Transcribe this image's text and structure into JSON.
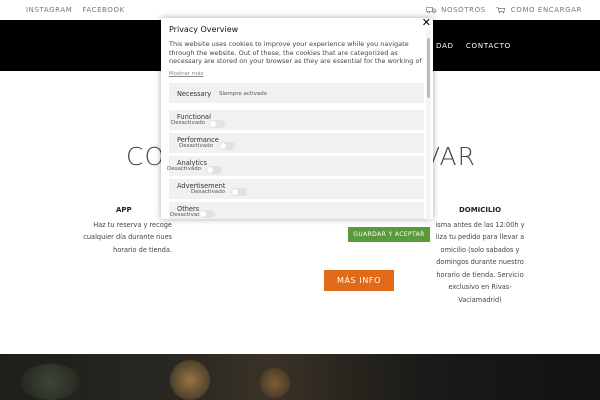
{
  "topbar": {
    "instagram": "INSTAGRAM",
    "facebook": "FACEBOOK",
    "nosotros": "NOSOTROS",
    "como_encargar": "COMO ENCARGAR"
  },
  "nav": {
    "partial_item": "DAD",
    "contacto": "CONTACTO"
  },
  "main": {
    "title_left": "CO",
    "title_right": "VAR",
    "app": {
      "title": "APP",
      "lines": [
        "Haz tu reserva y recoge",
        "cualquier día durante nues",
        "horario de tienda."
      ]
    },
    "domicilio": {
      "title": "DOMICILIO",
      "lines": [
        "isma antes de las 12:00h  y",
        "liza tu pedido para llevar a",
        "omicilio (solo sabados y",
        "domingos durante nuestro",
        "horario de tienda. Servicio",
        "exclusivo en Rivas-Vaciamadrid)"
      ]
    },
    "mas_info": "MÁS INFO"
  },
  "modal": {
    "title": "Privacy Overview",
    "description": "This website uses cookies to improve your experience while you navigate through the website. Out of these, the cookies that are categorized as necessary are stored on your browser as they are essential for the working of basic",
    "show_more": "Mostrar más",
    "categories": [
      {
        "name": "Necessary",
        "status": "Siempre activado",
        "toggle": false
      },
      {
        "name": "Functional",
        "status": "Desactivado",
        "toggle": true
      },
      {
        "name": "Performance",
        "status": "Desactivado",
        "toggle": true
      },
      {
        "name": "Analytics",
        "status": "Desactivado",
        "toggle": true
      },
      {
        "name": "Advertisement",
        "status": "Desactivado",
        "toggle": true
      },
      {
        "name": "Others",
        "status": "Desactivado",
        "toggle": true
      }
    ],
    "accept_button": "GUARDAR Y ACEPTAR"
  },
  "colors": {
    "header_bg": "#000000",
    "accent_orange": "#e06a17",
    "accept_green": "#5a9a3a"
  }
}
